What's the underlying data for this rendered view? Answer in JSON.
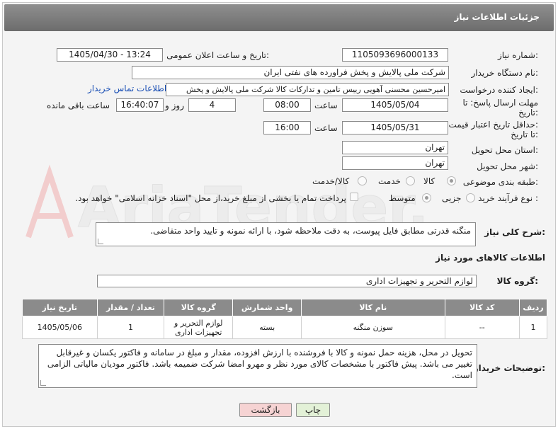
{
  "header": {
    "title": "جزئیات اطلاعات نیاز"
  },
  "watermark": {
    "text": "AriaTender.net"
  },
  "fields": {
    "need_number_label": "شماره نیاز:",
    "need_number": "1105093696000133",
    "announce_label": "تاریخ و ساعت اعلان عمومی:",
    "announce_value": "1405/04/30 - 13:24",
    "buyer_org_label": "نام دستگاه خریدار:",
    "buyer_org": "شرکت ملی پالایش و پخش فراورده های نفتی ایران",
    "requester_label": "ایجاد کننده درخواست:",
    "requester": "امیرحسین محسنی آهویی رییس تامین و تدارکات کالا شرکت ملی پالایش و پخش",
    "buyer_contact_link": "اطلاعات تماس خریدار",
    "reply_deadline_label_1": "مهلت ارسال پاسخ: تا",
    "reply_deadline_label_2": "تاریخ:",
    "reply_date": "1405/05/04",
    "time_label": "ساعت",
    "reply_time": "08:00",
    "days_value": "4",
    "days_label": "روز و",
    "remaining_time": "16:40:07",
    "remaining_label": "ساعت باقی مانده",
    "price_validity_label_1": "حداقل تاریخ اعتبار قیمت:",
    "price_validity_label_2": "تا تاریخ:",
    "price_date": "1405/05/31",
    "price_time_label": "ساعت",
    "price_time": "16:00",
    "province_label": "استان محل تحویل:",
    "province": "تهران",
    "city_label": "شهر محل تحویل:",
    "city": "تهران",
    "category_label": "طبقه بندی موضوعی:",
    "category_options": [
      "کالا",
      "خدمت",
      "کالا/خدمت"
    ],
    "process_label": "نوع فرآیند خرید :",
    "process_options": [
      "جزیی",
      "متوسط"
    ],
    "payment_note": "پرداخت تمام یا بخشی از مبلغ خرید،از محل \"اسناد خزانه اسلامی\" خواهد بود."
  },
  "description": {
    "label": "شرح کلی نیاز:",
    "text": "منگنه قدرتی مطابق فایل پیوست، به دقت ملاحظه شود، با ارائه نمونه و تایید واحد متقاضی."
  },
  "goods_section": {
    "title": "اطلاعات کالاهای مورد نیاز",
    "group_label": "گروه کالا:",
    "group_value": "لوازم التحریر و تجهیزات اداری"
  },
  "table": {
    "headers": [
      "ردیف",
      "کد کالا",
      "نام کالا",
      "واحد شمارش",
      "گروه کالا",
      "تعداد / مقدار",
      "تاریخ نیاز"
    ],
    "rows": [
      [
        "1",
        "--",
        "سوزن منگنه",
        "بسته",
        "لوازم التحریر و تجهیزات اداری",
        "1",
        "1405/05/06"
      ]
    ]
  },
  "buyer_notes": {
    "label": "توضیحات خریدار:",
    "text": "تحویل در محل، هزینه حمل نمونه و کالا با فروشنده با ارزش افزوده، مقدار و مبلغ در سامانه و فاکتور یکسان و غیرقابل تغییر می باشد. پیش فاکتور با مشخصات کالای مورد نظر و مهرو امضا شرکت ضمیمه باشد. فاکتور مودیان مالیاتی الزامی است."
  },
  "buttons": {
    "print": "چاپ",
    "back": "بازگشت"
  },
  "colors": {
    "back_button_bg": "#f6d3d3",
    "print_button_bg": "#e3f1d7",
    "header_bg": "#7a7a7a"
  }
}
